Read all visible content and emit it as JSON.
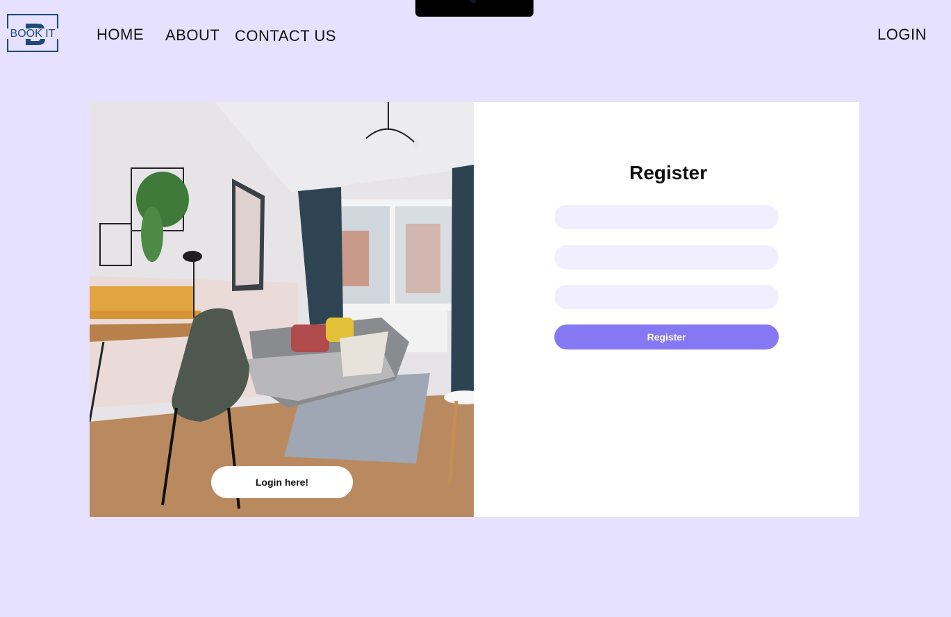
{
  "logo": {
    "text": "BOOK IT",
    "letter": "B"
  },
  "nav": {
    "home": "HOME",
    "about": "ABOUT",
    "contact": "CONTACT US",
    "login": "LOGIN"
  },
  "register": {
    "title": "Register",
    "fields": [
      {
        "placeholder": "",
        "value": ""
      },
      {
        "placeholder": "",
        "value": ""
      },
      {
        "placeholder": "",
        "value": ""
      }
    ],
    "button_label": "Register"
  },
  "photo": {
    "description": "living room interior photo",
    "login_button_label": "Login here!"
  },
  "colors": {
    "background": "#e6e1ff",
    "accent": "#8578f2",
    "field_bg": "#f1eeff",
    "logo": "#1f4a7a"
  }
}
